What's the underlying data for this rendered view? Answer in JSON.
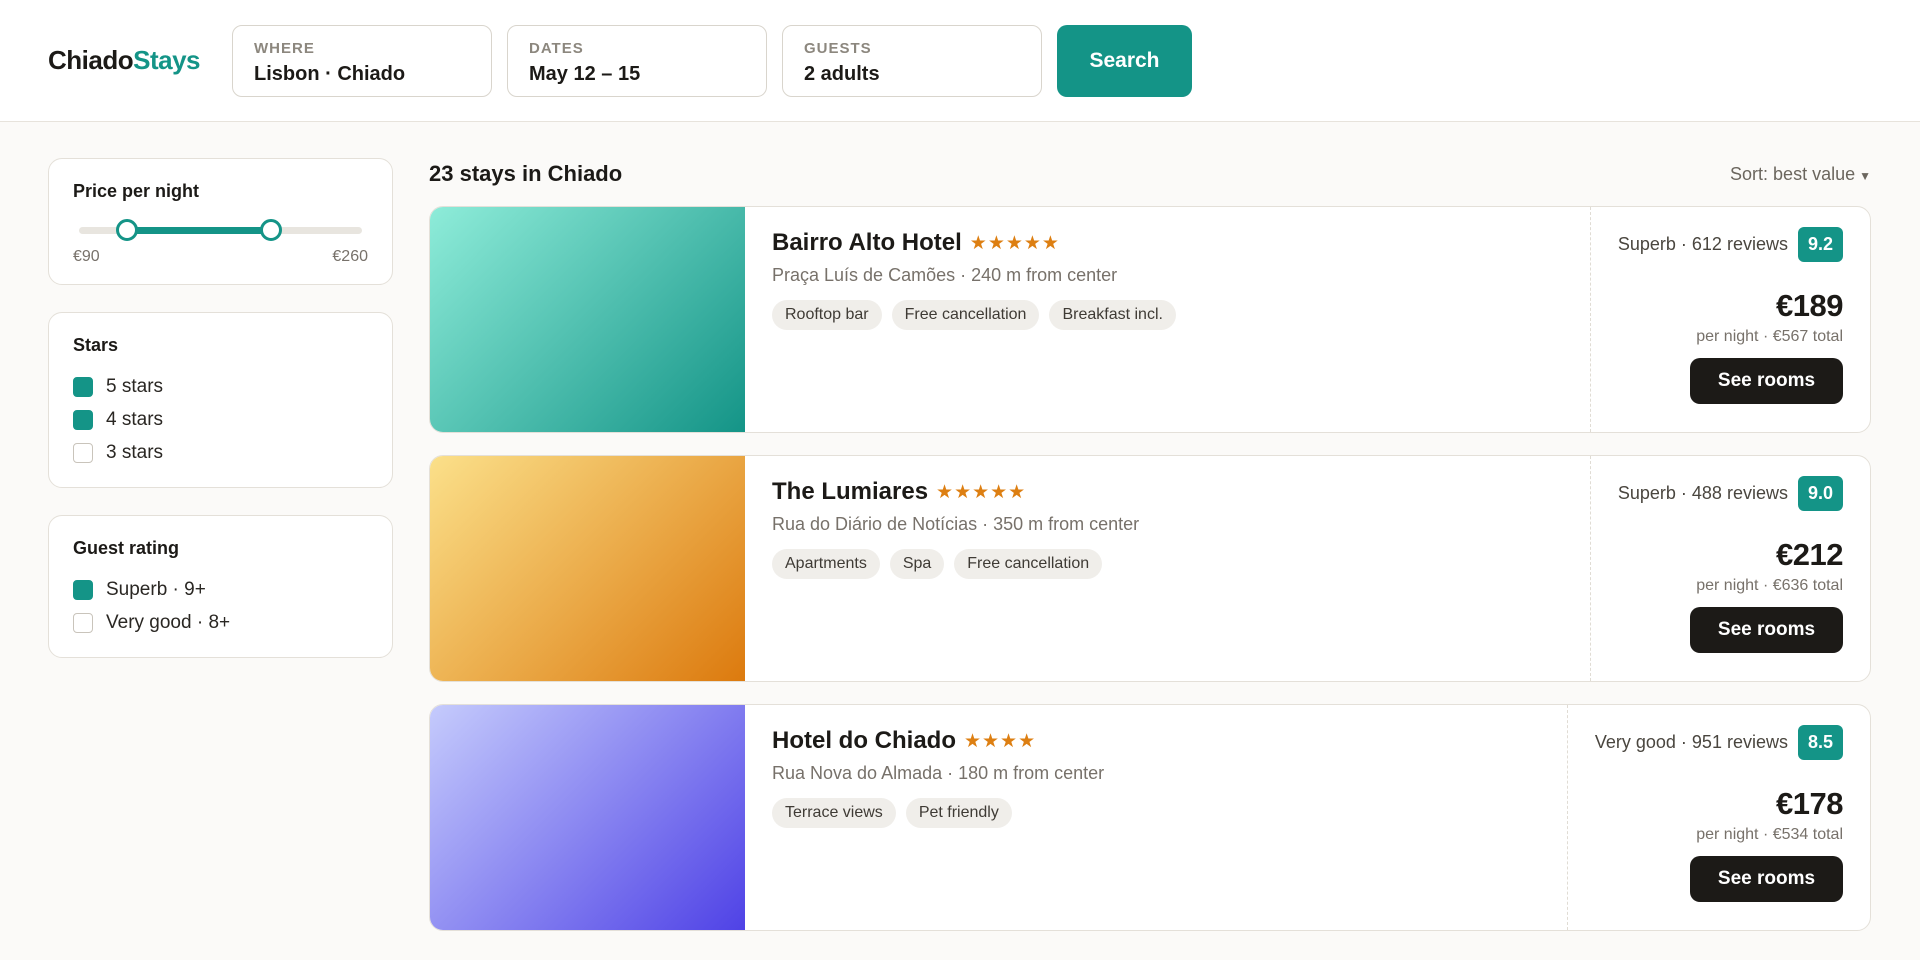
{
  "brand": {
    "name_part1": "Chiado",
    "name_part2": "Stays"
  },
  "search": {
    "fields": [
      {
        "label": "WHERE",
        "value": "Lisbon · Chiado"
      },
      {
        "label": "DATES",
        "value": "May 12 – 15"
      },
      {
        "label": "GUESTS",
        "value": "2 adults"
      }
    ],
    "button_label": "Search"
  },
  "filters": {
    "price": {
      "title": "Price per night",
      "min_label": "€90",
      "max_label": "€260",
      "low_fraction": 0.17,
      "high_fraction": 0.68
    },
    "stars": {
      "title": "Stars",
      "options": [
        {
          "label": "5 stars",
          "checked": true
        },
        {
          "label": "4 stars",
          "checked": true
        },
        {
          "label": "3 stars",
          "checked": false
        }
      ]
    },
    "guest_rating": {
      "title": "Guest rating",
      "options": [
        {
          "label": "Superb · 9+",
          "checked": true
        },
        {
          "label": "Very good · 8+",
          "checked": false
        }
      ]
    }
  },
  "results": {
    "count_label": "23 stays in Chiado",
    "sort_label": "Sort: best value",
    "listings": [
      {
        "name": "Bairro Alto Hotel",
        "stars": "★★★★★",
        "address": "Praça Luís de Camões · 240 m from center",
        "tags": [
          "Rooftop bar",
          "Free cancellation",
          "Breakfast incl."
        ],
        "rating_text": "Superb · 612 reviews",
        "rating": "9.2",
        "price": "€189",
        "price_sub": "per night · €567 total",
        "button_label": "See rooms",
        "gradient": [
          "#8eecd9",
          "#149487"
        ]
      },
      {
        "name": "The Lumiares",
        "stars": "★★★★★",
        "address": "Rua do Diário de Notícias · 350 m from center",
        "tags": [
          "Apartments",
          "Spa",
          "Free cancellation"
        ],
        "rating_text": "Superb · 488 reviews",
        "rating": "9.0",
        "price": "€212",
        "price_sub": "per night · €636 total",
        "button_label": "See rooms",
        "gradient": [
          "#fbe08a",
          "#dc7a0e"
        ]
      },
      {
        "name": "Hotel do Chiado",
        "stars": "★★★★",
        "address": "Rua Nova do Almada · 180 m from center",
        "tags": [
          "Terrace views",
          "Pet friendly"
        ],
        "rating_text": "Very good · 951 reviews",
        "rating": "8.5",
        "price": "€178",
        "price_sub": "per night · €534 total",
        "button_label": "See rooms",
        "gradient": [
          "#c5cbfc",
          "#4f42e6"
        ]
      }
    ]
  },
  "colors": {
    "accent": "#149487",
    "star": "#dd7f12",
    "dark": "#1c1a17"
  }
}
